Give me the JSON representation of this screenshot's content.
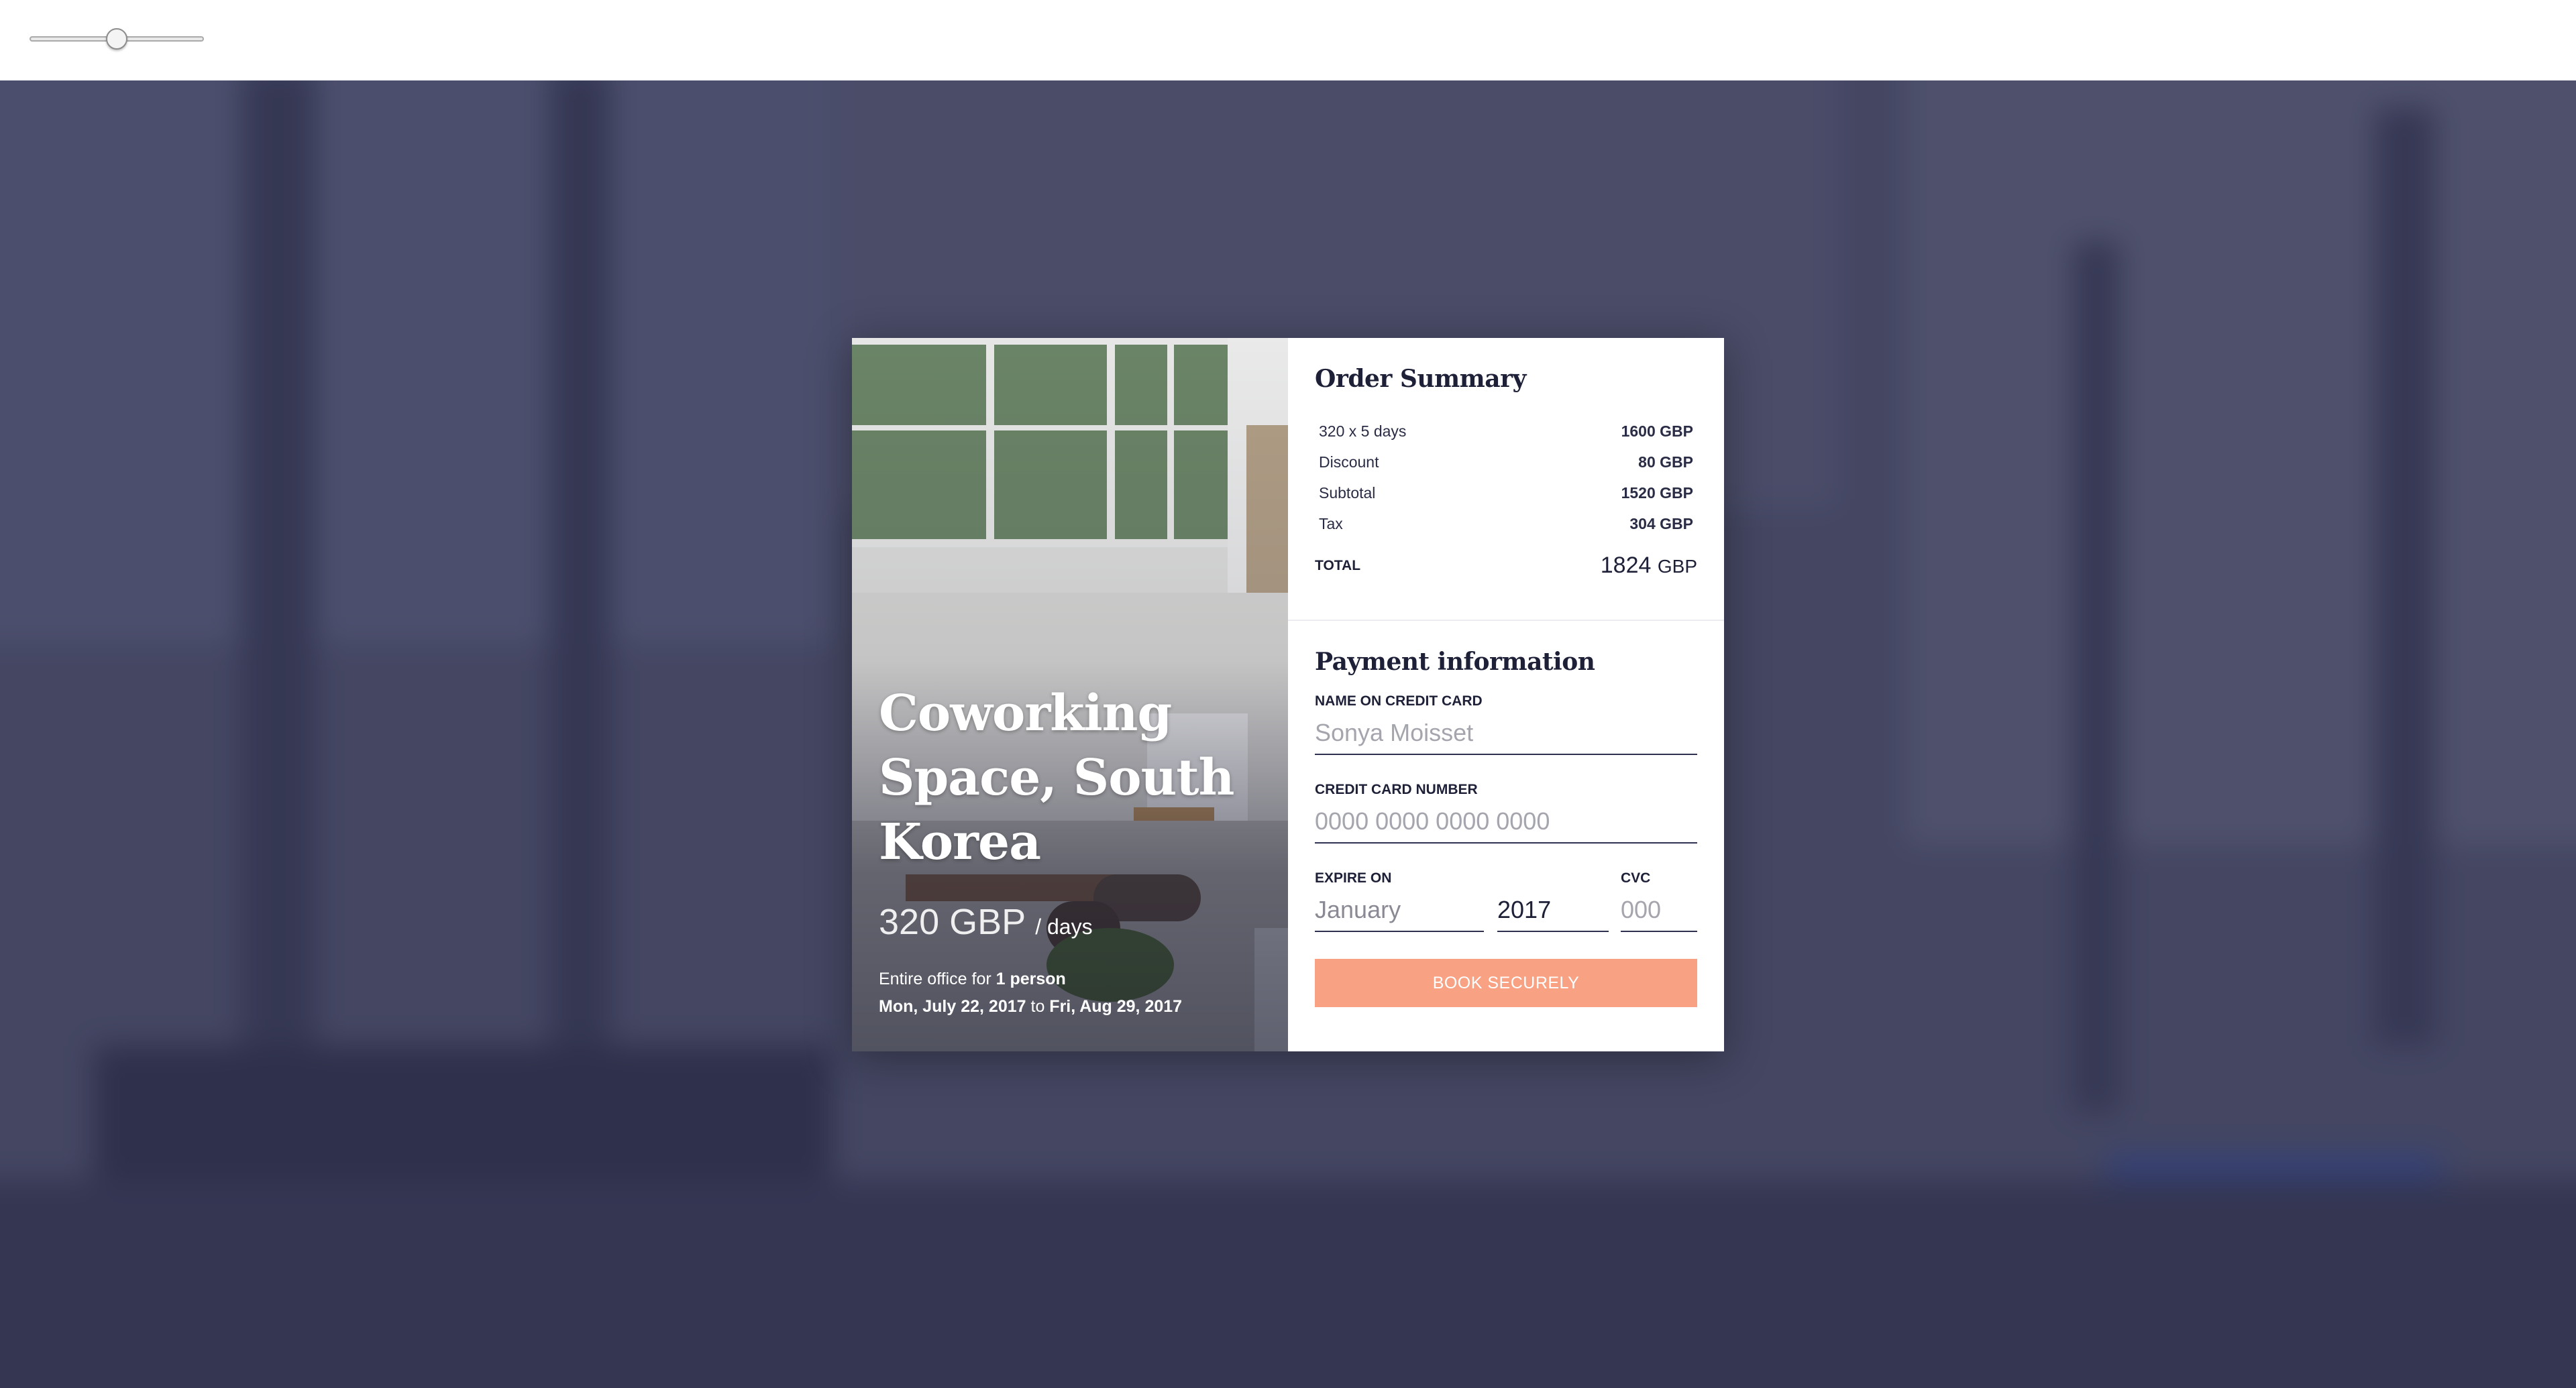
{
  "zoom_slider": {
    "value_fraction": 0.5
  },
  "listing": {
    "title": "Coworking Space, South Korea",
    "price": "320 GBP",
    "price_unit": "/ days",
    "office_prefix": "Entire office for ",
    "office_people": "1 person",
    "date_from": "Mon, July 22, 2017",
    "date_to_word": " to ",
    "date_to": "Fri, Aug 29, 2017"
  },
  "order_summary": {
    "title": "Order Summary",
    "rows": [
      {
        "label": "320 x 5 days",
        "value": "1600 GBP"
      },
      {
        "label": "Discount",
        "value": "80 GBP"
      },
      {
        "label": "Subtotal",
        "value": "1520 GBP"
      },
      {
        "label": "Tax",
        "value": "304 GBP"
      }
    ],
    "total_label": "TOTAL",
    "total_amount": "1824",
    "total_currency": "GBP"
  },
  "payment": {
    "title": "Payment information",
    "name_label": "NAME ON CREDIT CARD",
    "name_placeholder": "Sonya Moisset",
    "card_label": "CREDIT CARD NUMBER",
    "card_placeholder": "0000 0000 0000 0000",
    "expire_label": "EXPIRE ON",
    "expire_month": "January",
    "expire_year": "2017",
    "cvc_label": "CVC",
    "cvc_placeholder": "000",
    "submit_label": "BOOK SECURELY"
  },
  "colors": {
    "accent_button": "#f9a183",
    "text_dark": "#1e2038",
    "overlay": "#4d4f66"
  }
}
